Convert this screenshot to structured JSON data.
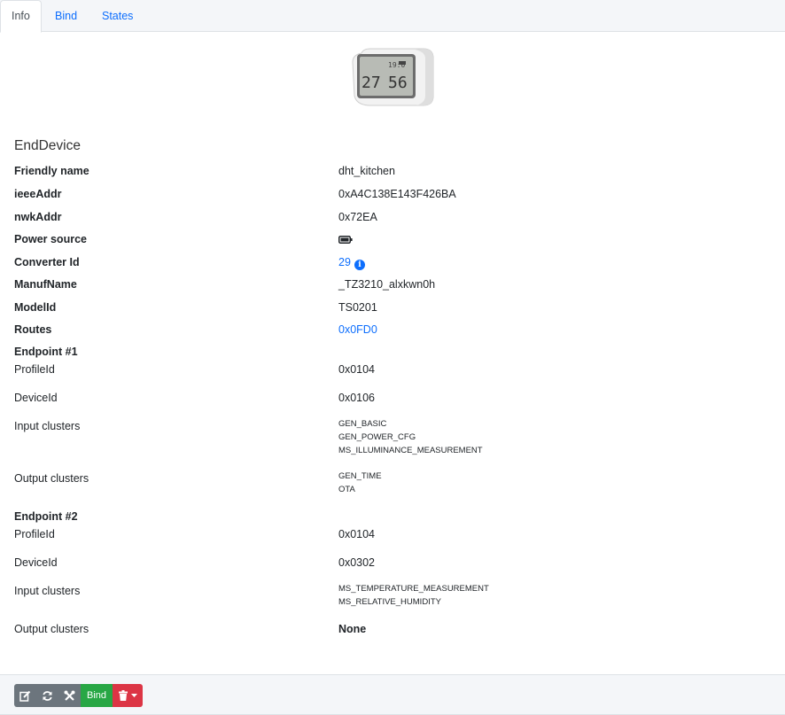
{
  "tabs": [
    {
      "label": "Info"
    },
    {
      "label": "Bind"
    },
    {
      "label": "States"
    }
  ],
  "device": {
    "type": "EndDevice",
    "screen_temp": "27",
    "screen_hum": "56"
  },
  "fields": {
    "friendly_name": {
      "label": "Friendly name",
      "value": "dht_kitchen"
    },
    "ieee": {
      "label": "ieeeAddr",
      "value": "0xA4C138E143F426BA"
    },
    "nwk": {
      "label": "nwkAddr",
      "value": "0x72EA"
    },
    "power": {
      "label": "Power source",
      "icon": "battery-icon"
    },
    "converter": {
      "label": "Converter Id",
      "value": "29",
      "icon": "info-circle-icon"
    },
    "manuf": {
      "label": "ManufName",
      "value": "_TZ3210_alxkwn0h"
    },
    "model": {
      "label": "ModelId",
      "value": "TS0201"
    },
    "routes": {
      "label": "Routes",
      "value": "0x0FD0"
    }
  },
  "endpoints": [
    {
      "title": "Endpoint #1",
      "profile_label": "ProfileId",
      "profile": "0x0104",
      "device_label": "DeviceId",
      "device": "0x0106",
      "input_label": "Input clusters",
      "inputs": [
        "GEN_BASIC",
        "GEN_POWER_CFG",
        "MS_ILLUMINANCE_MEASUREMENT"
      ],
      "output_label": "Output clusters",
      "outputs": [
        "GEN_TIME",
        "OTA"
      ]
    },
    {
      "title": "Endpoint #2",
      "profile_label": "ProfileId",
      "profile": "0x0104",
      "device_label": "DeviceId",
      "device": "0x0302",
      "input_label": "Input clusters",
      "inputs": [
        "MS_TEMPERATURE_MEASUREMENT",
        "MS_RELATIVE_HUMIDITY"
      ],
      "output_label": "Output clusters",
      "outputs_none": "None"
    }
  ],
  "toolbar": {
    "edit_icon": "edit-icon",
    "refresh_icon": "refresh-icon",
    "tools_icon": "tools-icon",
    "bind_label": "Bind",
    "delete_icon": "trash-icon"
  },
  "colors": {
    "link": "#0d6efd",
    "bind_button": "#28a745",
    "delete_button": "#dc3545",
    "tool_button": "#6c757d"
  }
}
